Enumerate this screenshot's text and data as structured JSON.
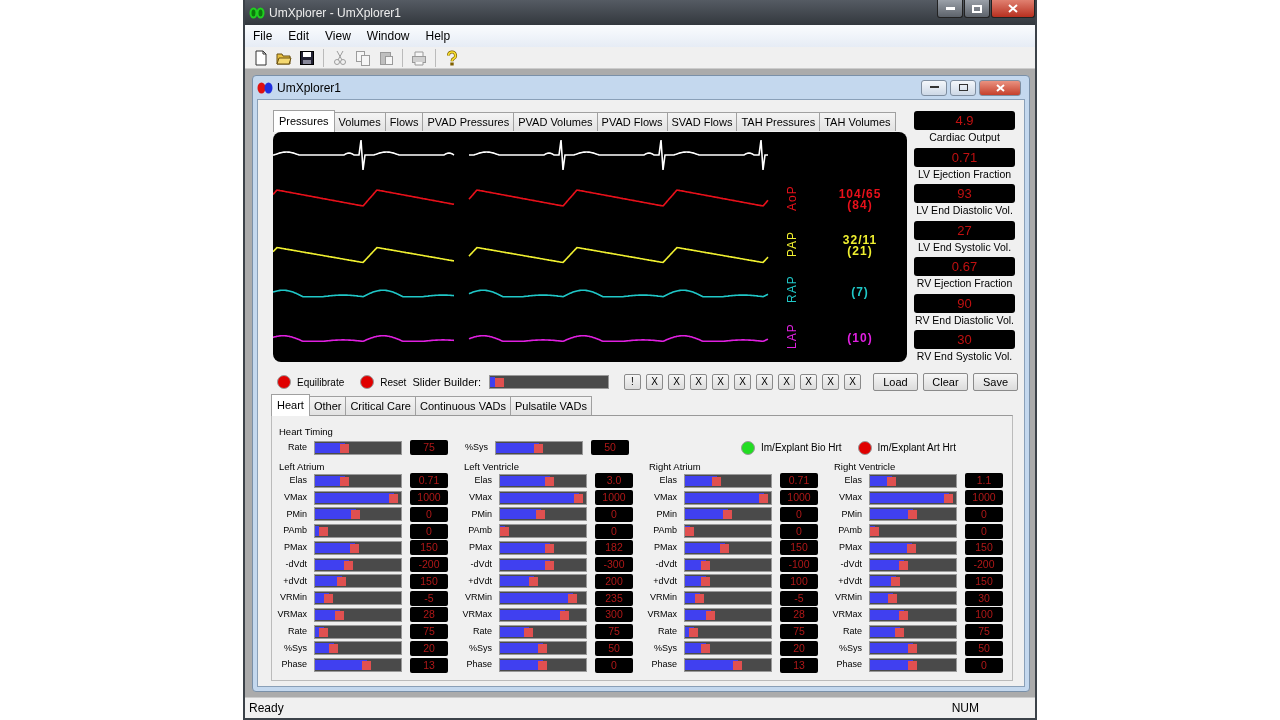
{
  "window": {
    "title": "UmXplorer - UmXplorer1"
  },
  "menu": [
    "File",
    "Edit",
    "View",
    "Window",
    "Help"
  ],
  "toolbar": [
    {
      "kind": "new",
      "disabled": false
    },
    {
      "kind": "open",
      "disabled": false
    },
    {
      "kind": "save",
      "disabled": false
    },
    {
      "kind": "cut",
      "disabled": true
    },
    {
      "kind": "copy",
      "disabled": true
    },
    {
      "kind": "paste",
      "disabled": true
    },
    {
      "kind": "print",
      "disabled": true
    },
    {
      "kind": "help",
      "disabled": false
    }
  ],
  "child_window": {
    "title": "UmXplorer1"
  },
  "tabs": [
    {
      "label": "Pressures",
      "selected": true
    },
    {
      "label": "Volumes",
      "selected": false
    },
    {
      "label": "Flows",
      "selected": false
    },
    {
      "label": "PVAD Pressures",
      "selected": false
    },
    {
      "label": "PVAD Volumes",
      "selected": false
    },
    {
      "label": "PVAD Flows",
      "selected": false
    },
    {
      "label": "SVAD Flows",
      "selected": false
    },
    {
      "label": "TAH Pressures",
      "selected": false
    },
    {
      "label": "TAH Volumes",
      "selected": false
    }
  ],
  "monitor": {
    "channels": [
      {
        "label": "AoP",
        "reading": [
          "104/65",
          "(84)"
        ],
        "color": "#e8101a"
      },
      {
        "label": "PAP",
        "reading": [
          "32/11",
          "(21)"
        ],
        "color": "#f0f030"
      },
      {
        "label": "RAP",
        "reading": [
          "(7)"
        ],
        "color": "#20c8c8"
      },
      {
        "label": "LAP",
        "reading": [
          "(10)"
        ],
        "color": "#e020e0"
      }
    ]
  },
  "readouts": [
    {
      "value": "4.9",
      "label": "Cardiac Output"
    },
    {
      "value": "0.71",
      "label": "LV Ejection Fraction"
    },
    {
      "value": "93",
      "label": "LV End Diastolic Vol."
    },
    {
      "value": "27",
      "label": "LV End Systolic Vol."
    },
    {
      "value": "0.67",
      "label": "RV Ejection Fraction"
    },
    {
      "value": "90",
      "label": "RV End Diastolic Vol."
    },
    {
      "value": "30",
      "label": "RV End Systolic Vol."
    }
  ],
  "controls": {
    "lights": [
      {
        "label": "Equilibrate",
        "color": "#e00000"
      },
      {
        "label": "Reset",
        "color": "#e00000"
      }
    ],
    "slider_builder": {
      "label": "Slider Builder:",
      "level": 0.04
    },
    "builder_buttons": [
      "!",
      "X",
      "X",
      "X",
      "X",
      "X",
      "X",
      "X",
      "X",
      "X",
      "X"
    ],
    "buttons": [
      "Load",
      "Clear",
      "Save"
    ]
  },
  "lower_tabs": [
    {
      "label": "Heart",
      "selected": true
    },
    {
      "label": "Other",
      "selected": false
    },
    {
      "label": "Critical Care",
      "selected": false
    },
    {
      "label": "Continuous VADs",
      "selected": false
    },
    {
      "label": "Pulsatile VADs",
      "selected": false
    }
  ],
  "heart_timing": {
    "title": "Heart Timing",
    "sliders": [
      {
        "label": "Rate",
        "level": 0.35,
        "value": "75"
      },
      {
        "label": "%Sys",
        "level": 0.5,
        "value": "50"
      }
    ],
    "lights": [
      {
        "label": "Im/Explant Bio Hrt",
        "color": "#22dd22"
      },
      {
        "label": "Im/Explant Art Hrt",
        "color": "#e00000"
      }
    ]
  },
  "chambers": [
    {
      "title": "Left Atrium",
      "sliders": [
        {
          "label": "Elas",
          "level": 0.35,
          "value": "0.71"
        },
        {
          "label": "VMax",
          "level": 0.92,
          "value": "1000"
        },
        {
          "label": "PMin",
          "level": 0.48,
          "value": "0"
        },
        {
          "label": "PAmb",
          "level": 0.05,
          "value": "0"
        },
        {
          "label": "PMax",
          "level": 0.47,
          "value": "150"
        },
        {
          "label": "-dVdt",
          "level": 0.39,
          "value": "-200"
        },
        {
          "label": "+dVdt",
          "level": 0.31,
          "value": "150"
        },
        {
          "label": "VRMin",
          "level": 0.16,
          "value": "-5"
        },
        {
          "label": "VRMax",
          "level": 0.29,
          "value": "28"
        },
        {
          "label": "Rate",
          "level": 0.11,
          "value": "75"
        },
        {
          "label": "%Sys",
          "level": 0.22,
          "value": "20"
        },
        {
          "label": "Phase",
          "level": 0.6,
          "value": "13"
        }
      ]
    },
    {
      "title": "Left Ventricle",
      "sliders": [
        {
          "label": "Elas",
          "level": 0.58,
          "value": "3.0"
        },
        {
          "label": "VMax",
          "level": 0.92,
          "value": "1000"
        },
        {
          "label": "PMin",
          "level": 0.48,
          "value": "0"
        },
        {
          "label": "PAmb",
          "level": 0.06,
          "value": "0"
        },
        {
          "label": "PMax",
          "level": 0.58,
          "value": "182"
        },
        {
          "label": "-dVdt",
          "level": 0.58,
          "value": "-300"
        },
        {
          "label": "+dVdt",
          "level": 0.4,
          "value": "200"
        },
        {
          "label": "VRMin",
          "level": 0.85,
          "value": "235"
        },
        {
          "label": "VRMax",
          "level": 0.75,
          "value": "300"
        },
        {
          "label": "Rate",
          "level": 0.34,
          "value": "75"
        },
        {
          "label": "%Sys",
          "level": 0.5,
          "value": "50"
        },
        {
          "label": "Phase",
          "level": 0.5,
          "value": "0"
        }
      ]
    },
    {
      "title": "Right Atrium",
      "sliders": [
        {
          "label": "Elas",
          "level": 0.37,
          "value": "0.71"
        },
        {
          "label": "VMax",
          "level": 0.92,
          "value": "1000"
        },
        {
          "label": "PMin",
          "level": 0.5,
          "value": "0"
        },
        {
          "label": "PAmb",
          "level": 0.06,
          "value": "0"
        },
        {
          "label": "PMax",
          "level": 0.47,
          "value": "150"
        },
        {
          "label": "-dVdt",
          "level": 0.24,
          "value": "-100"
        },
        {
          "label": "+dVdt",
          "level": 0.24,
          "value": "100"
        },
        {
          "label": "VRMin",
          "level": 0.17,
          "value": "-5"
        },
        {
          "label": "VRMax",
          "level": 0.3,
          "value": "28"
        },
        {
          "label": "Rate",
          "level": 0.11,
          "value": "75"
        },
        {
          "label": "%Sys",
          "level": 0.24,
          "value": "20"
        },
        {
          "label": "Phase",
          "level": 0.62,
          "value": "13"
        }
      ]
    },
    {
      "title": "Right Ventricle",
      "sliders": [
        {
          "label": "Elas",
          "level": 0.25,
          "value": "1.1"
        },
        {
          "label": "VMax",
          "level": 0.92,
          "value": "1000"
        },
        {
          "label": "PMin",
          "level": 0.5,
          "value": "0"
        },
        {
          "label": "PAmb",
          "level": 0.06,
          "value": "0"
        },
        {
          "label": "PMax",
          "level": 0.49,
          "value": "150"
        },
        {
          "label": "-dVdt",
          "level": 0.39,
          "value": "-200"
        },
        {
          "label": "+dVdt",
          "level": 0.3,
          "value": "150"
        },
        {
          "label": "VRMin",
          "level": 0.27,
          "value": "30"
        },
        {
          "label": "VRMax",
          "level": 0.39,
          "value": "100"
        },
        {
          "label": "Rate",
          "level": 0.35,
          "value": "75"
        },
        {
          "label": "%Sys",
          "level": 0.5,
          "value": "50"
        },
        {
          "label": "Phase",
          "level": 0.5,
          "value": "0"
        }
      ]
    }
  ],
  "status_bar": {
    "text": "Ready",
    "indicator": "NUM"
  }
}
